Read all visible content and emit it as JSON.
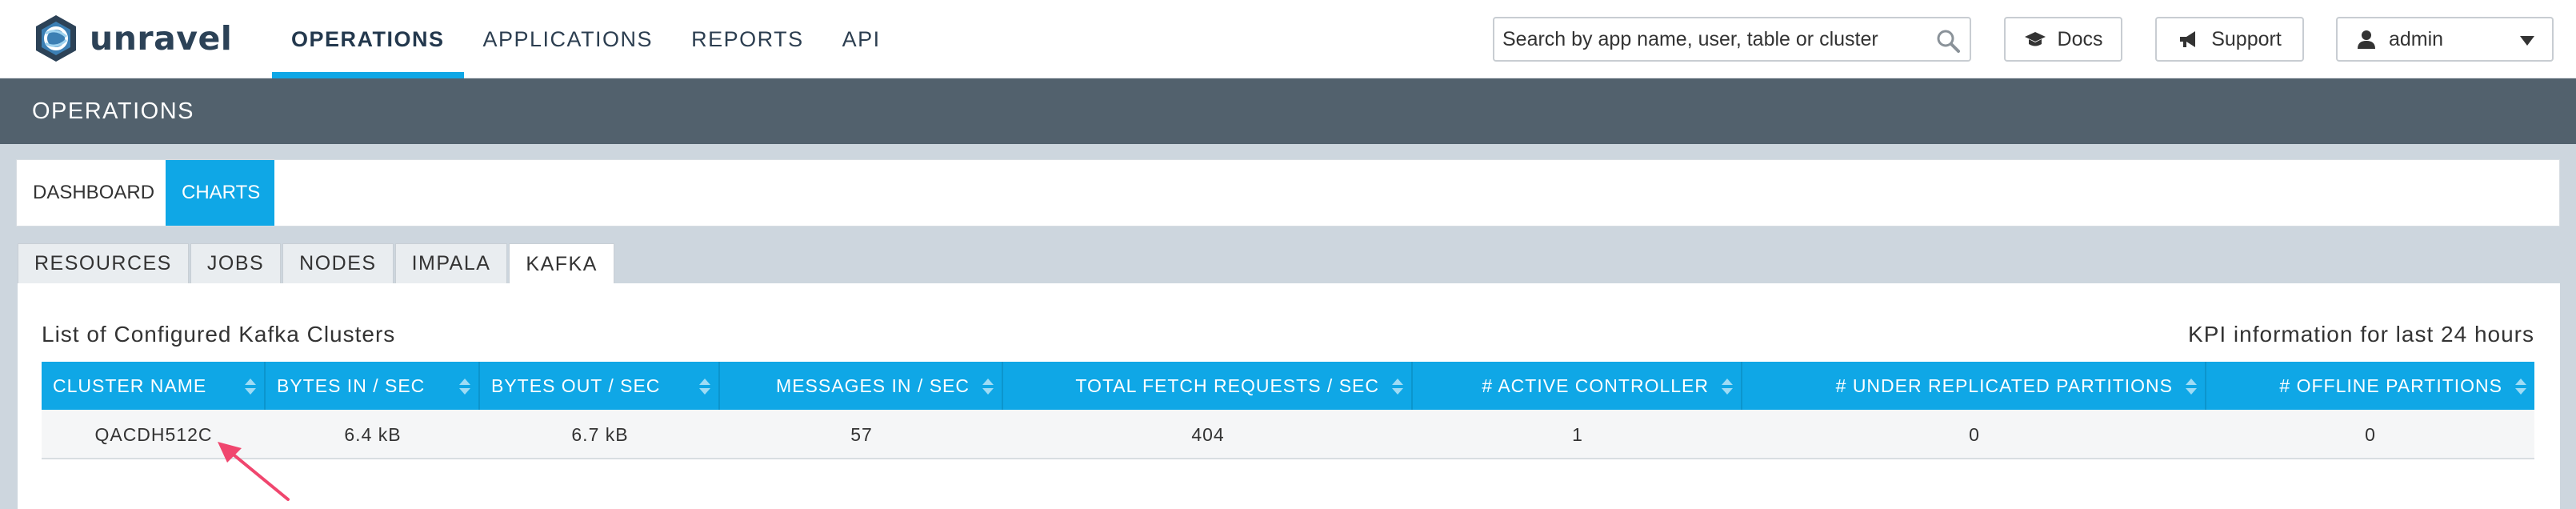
{
  "brand": {
    "name": "unravel"
  },
  "nav": {
    "items": [
      {
        "label": "OPERATIONS",
        "active": true
      },
      {
        "label": "APPLICATIONS",
        "active": false
      },
      {
        "label": "REPORTS",
        "active": false
      },
      {
        "label": "API",
        "active": false
      }
    ]
  },
  "search": {
    "placeholder": "Search by app name, user, table or cluster",
    "icon": "search-icon"
  },
  "header_buttons": {
    "docs": "Docs",
    "support": "Support",
    "user": "admin"
  },
  "section": {
    "title": "OPERATIONS"
  },
  "main_tabs": [
    {
      "label": "DASHBOARD",
      "active": false
    },
    {
      "label": "CHARTS",
      "active": true
    }
  ],
  "chart_tabs": [
    {
      "label": "RESOURCES",
      "active": false
    },
    {
      "label": "JOBS",
      "active": false
    },
    {
      "label": "NODES",
      "active": false
    },
    {
      "label": "IMPALA",
      "active": false
    },
    {
      "label": "KAFKA",
      "active": true
    }
  ],
  "kafka": {
    "title": "List of Configured Kafka Clusters",
    "kpi_note": "KPI information for last 24 hours",
    "columns": [
      "CLUSTER NAME",
      "BYTES IN / SEC",
      "BYTES OUT / SEC",
      "MESSAGES IN / SEC",
      "TOTAL FETCH REQUESTS / SEC",
      "# ACTIVE CONTROLLER",
      "# UNDER REPLICATED PARTITIONS",
      "# OFFLINE PARTITIONS"
    ],
    "rows": [
      [
        "QACDH512C",
        "6.4 kB",
        "6.7 kB",
        "57",
        "404",
        "1",
        "0",
        "0"
      ]
    ]
  },
  "colors": {
    "accent": "#0fa7e6",
    "header_bar": "#52616d",
    "annotation_arrow": "#f0466e"
  }
}
